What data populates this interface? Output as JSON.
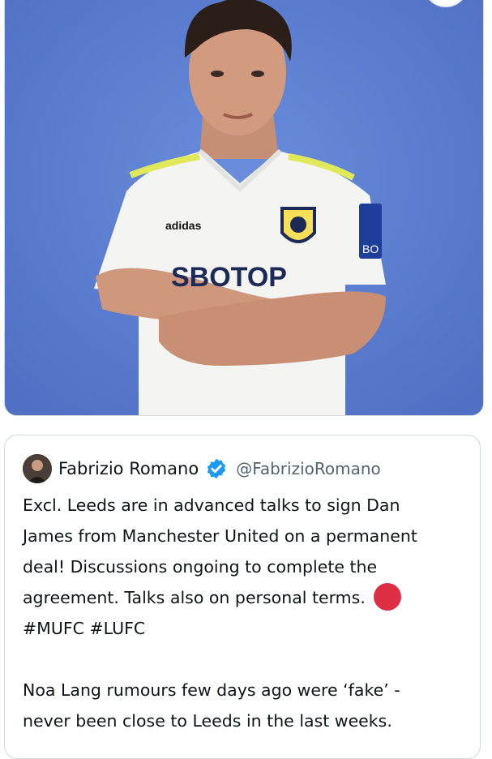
{
  "tweet": {
    "author": {
      "display_name": "Fabrizio Romano",
      "handle": "@FabrizioRomano",
      "verified": true
    },
    "text_lines": {
      "l1": "Excl.  Leeds are in advanced talks to sign Dan",
      "l2": "James from Manchester United on a permanent",
      "l3": "deal!  Discussions ongoing to complete the",
      "l4": "agreement.  Talks also on personal terms.",
      "l5": "#MUFC #LUFC",
      "l6": "Noa Lang rumours few days ago were  ‘fake’  -",
      "l7": "never been close to Leeds in the last weeks."
    },
    "emoji": "red-circle",
    "image": {
      "jersey_brand": "adidas",
      "jersey_sponsor": "SBOTOP",
      "sleeve_text": "BO"
    }
  },
  "colors": {
    "photo_background": "#5b7ed2",
    "verified_blue": "#1d9bf0",
    "text": "#0f1419",
    "secondary_text": "#536471",
    "red_circle": "#dd2e44",
    "border": "#cfd9de"
  }
}
